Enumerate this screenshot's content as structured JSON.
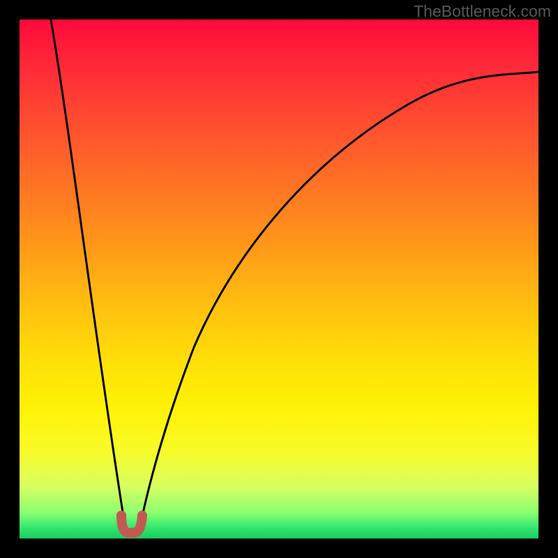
{
  "watermark": {
    "text": "TheBottleneck.com"
  },
  "chart_data": {
    "type": "line",
    "title": "",
    "xlabel": "",
    "ylabel": "",
    "xlim": [
      0,
      100
    ],
    "ylim": [
      0,
      100
    ],
    "series": [
      {
        "name": "left-branch",
        "x": [
          6,
          8,
          10,
          12,
          14,
          16,
          18,
          19.5,
          20.5
        ],
        "y": [
          100,
          84,
          68,
          53,
          38,
          24,
          11,
          3,
          1
        ]
      },
      {
        "name": "right-branch",
        "x": [
          23,
          24,
          26,
          29,
          33,
          40,
          50,
          62,
          76,
          90,
          100
        ],
        "y": [
          1,
          3,
          12,
          26,
          42,
          58,
          70,
          78,
          84,
          88,
          90
        ]
      },
      {
        "name": "minimum-marker",
        "x": [
          19.5,
          20,
          20.8,
          22,
          23,
          23.4
        ],
        "y": [
          3.2,
          1.6,
          1.1,
          1.1,
          1.8,
          3.4
        ]
      }
    ],
    "colors": {
      "curve": "#000000",
      "marker": "#c25a52",
      "gradient_top": "#ff0a3a",
      "gradient_bottom": "#18ce5e"
    }
  }
}
